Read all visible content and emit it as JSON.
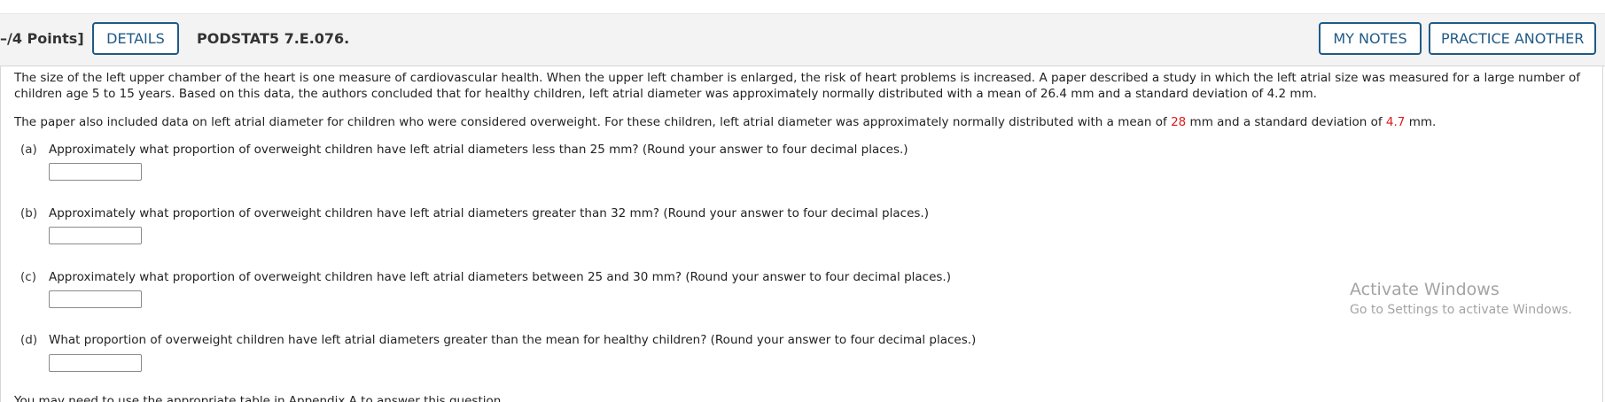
{
  "header": {
    "points": "–/4 Points]",
    "details_label": "DETAILS",
    "problem_code": "PODSTAT5 7.E.076.",
    "my_notes_label": "MY NOTES",
    "practice_another_label": "PRACTICE ANOTHER"
  },
  "intro": {
    "p1": "The size of the left upper chamber of the heart is one measure of cardiovascular health. When the upper left chamber is enlarged, the risk of heart problems is increased. A paper described a study in which the left atrial size was measured for a large number of children age 5 to 15 years. Based on this data, the authors concluded that for healthy children, left atrial diameter was approximately normally distributed with a mean of 26.4 mm and a standard deviation of 4.2 mm.",
    "p2_a": "The paper also included data on left atrial diameter for children who were considered overweight. For these children, left atrial diameter was approximately normally distributed with a mean of ",
    "p2_mean": "28",
    "p2_b": " mm and a standard deviation of ",
    "p2_sd": "4.7",
    "p2_c": " mm."
  },
  "questions": [
    {
      "label": "(a)",
      "text": "Approximately what proportion of overweight children have left atrial diameters less than 25 mm? (Round your answer to four decimal places.)",
      "value": ""
    },
    {
      "label": "(b)",
      "text": "Approximately what proportion of overweight children have left atrial diameters greater than 32 mm? (Round your answer to four decimal places.)",
      "value": ""
    },
    {
      "label": "(c)",
      "text": "Approximately what proportion of overweight children have left atrial diameters between 25 and 30 mm? (Round your answer to four decimal places.)",
      "value": ""
    },
    {
      "label": "(d)",
      "text": "What proportion of overweight children have left atrial diameters greater than the mean for healthy children? (Round your answer to four decimal places.)",
      "value": ""
    }
  ],
  "footer_cutoff": "You may need to use the appropriate table in Appendix A to answer this question.",
  "watermark": {
    "title": "Activate Windows",
    "subtitle": "Go to Settings to activate Windows."
  },
  "colors": {
    "accent": "#1f5a87",
    "highlight": "#e0191b"
  }
}
